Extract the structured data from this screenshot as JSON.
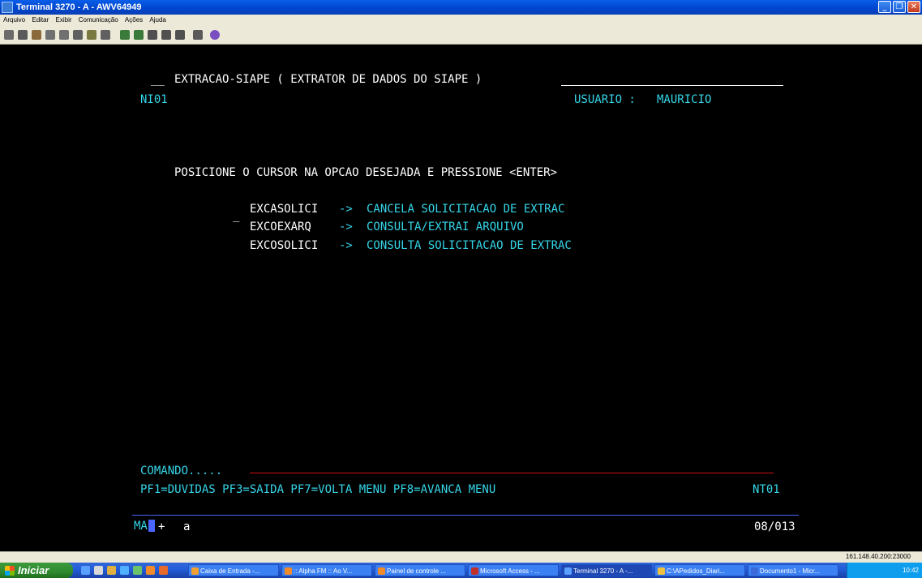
{
  "window": {
    "title": "Terminal 3270 - A - AWV64949",
    "buttons": [
      "_",
      "❐",
      "✕"
    ]
  },
  "menu": [
    "Arquivo",
    "Editar",
    "Exibir",
    "Comunicação",
    "Ações",
    "Ajuda"
  ],
  "screen": {
    "header_prefix": "__",
    "header_title": "EXTRACAO-SIAPE ( EXTRATOR DE DADOS DO SIAPE )",
    "screen_id": "NI01",
    "user_label": "USUARIO :",
    "user_name": "MAURICIO",
    "instruction": "POSICIONE O CURSOR NA OPCAO DESEJADA E PRESSIONE <ENTER>",
    "cursor_marker": "_",
    "options": [
      {
        "code": "EXCASOLICI",
        "arrow": "->",
        "desc": "CANCELA SOLICITACAO DE EXTRAC"
      },
      {
        "code": "EXCOEXARQ",
        "arrow": "->",
        "desc": "CONSULTA/EXTRAI ARQUIVO"
      },
      {
        "code": "EXCOSOLICI",
        "arrow": "->",
        "desc": "CONSULTA SOLICITACAO DE EXTRAC"
      }
    ],
    "command_label": "COMANDO.....",
    "pf_keys": "PF1=DUVIDAS PF3=SAIDA PF7=VOLTA MENU PF8=AVANCA MENU",
    "terminal_id": "NT01",
    "oia_mode": "MA",
    "oia_plus": "+",
    "oia_a": "a",
    "cursor_pos": "08/013"
  },
  "status": {
    "address": "161.148.40.200:23000"
  },
  "taskbar": {
    "start_label": "Iniciar",
    "tasks": [
      "Caixa de Entrada -...",
      ":: Alpha FM :: Ao V...",
      "Painel de controle ...",
      "Microsoft Access - ...",
      "Terminal 3270 - A -...",
      "C:\\APedidos_Diari...",
      "Documento1 - Micr..."
    ],
    "clock": "10:42"
  }
}
